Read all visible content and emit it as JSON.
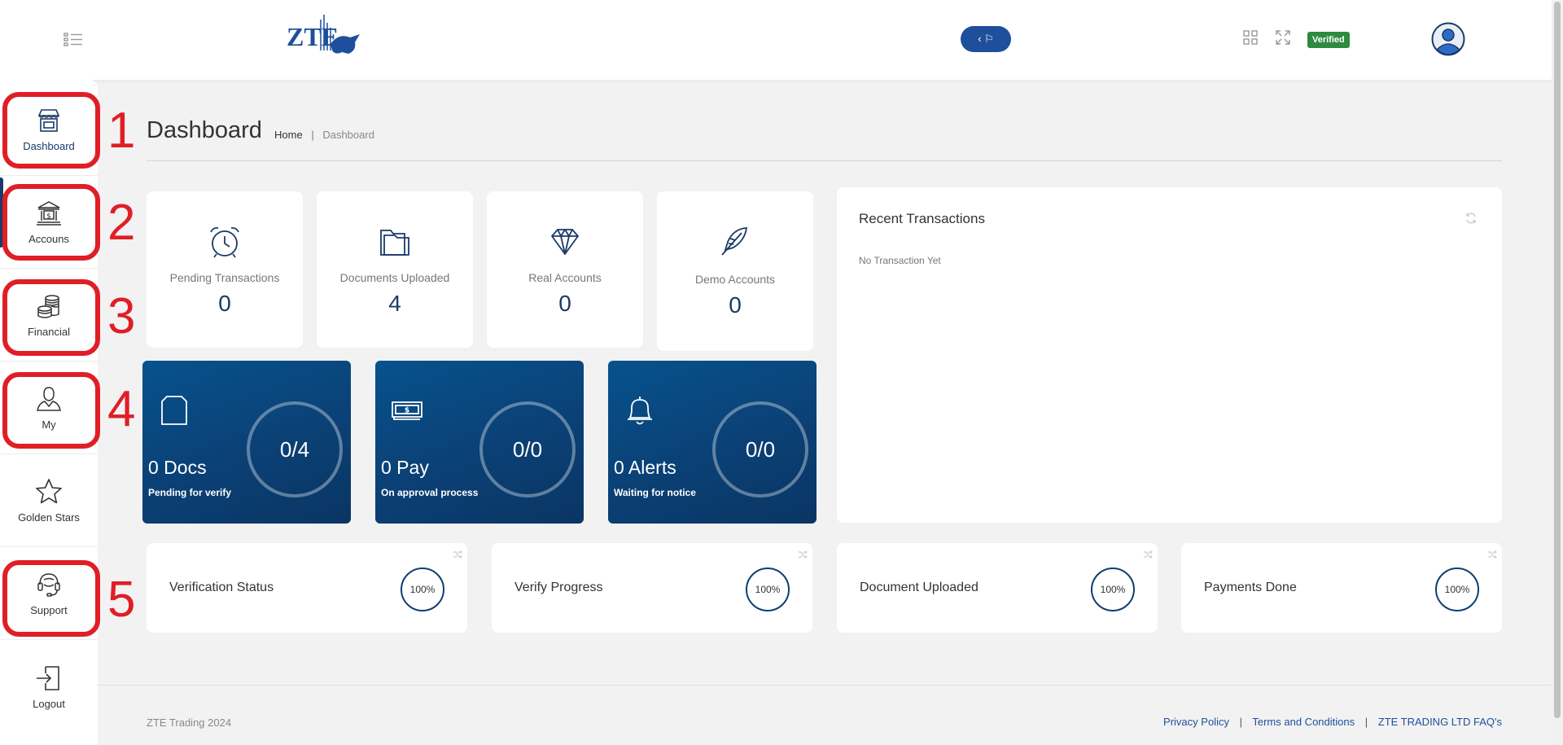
{
  "header": {
    "logo_text": "ZTE",
    "flag_button_label": "‹ ⚐",
    "verified_badge": "Verified"
  },
  "sidebar": {
    "items": [
      {
        "label": "Dashboard",
        "icon": "shop-icon"
      },
      {
        "label": "Accouns",
        "icon": "bank-icon"
      },
      {
        "label": "Financial",
        "icon": "coins-icon"
      },
      {
        "label": "My",
        "icon": "user-icon"
      },
      {
        "label": "Golden Stars",
        "icon": "star-icon"
      },
      {
        "label": "Support",
        "icon": "headset-icon"
      },
      {
        "label": "Logout",
        "icon": "logout-icon"
      }
    ]
  },
  "annotations": [
    "1",
    "2",
    "3",
    "4",
    "5"
  ],
  "page": {
    "title": "Dashboard",
    "breadcrumb": {
      "home": "Home",
      "separator": "|",
      "current": "Dashboard"
    }
  },
  "stats": [
    {
      "label": "Pending Transactions",
      "value": "0",
      "icon": "alarm-clock-icon"
    },
    {
      "label": "Documents Uploaded",
      "value": "4",
      "icon": "folder-icon"
    },
    {
      "label": "Real Accounts",
      "value": "0",
      "icon": "diamond-icon"
    },
    {
      "label": "Demo Accounts",
      "value": "0",
      "icon": "feather-icon"
    }
  ],
  "status_cards": [
    {
      "title": "0 Docs",
      "subtitle": "Pending for verify",
      "ratio": "0/4",
      "icon": "document-icon"
    },
    {
      "title": "0 Pay",
      "subtitle": "On approval process",
      "ratio": "0/0",
      "icon": "cash-icon"
    },
    {
      "title": "0 Alerts",
      "subtitle": "Waiting for notice",
      "ratio": "0/0",
      "icon": "bell-icon"
    }
  ],
  "recent_transactions": {
    "title": "Recent Transactions",
    "empty_text": "No Transaction Yet"
  },
  "progress_cards": [
    {
      "label": "Verification Status",
      "percent": "100%"
    },
    {
      "label": "Verify Progress",
      "percent": "100%"
    },
    {
      "label": "Document Uploaded",
      "percent": "100%"
    },
    {
      "label": "Payments Done",
      "percent": "100%"
    }
  ],
  "footer": {
    "copyright": "ZTE Trading 2024",
    "links": [
      "Privacy Policy",
      "Terms and Conditions",
      "ZTE TRADING LTD FAQ's"
    ],
    "separator": "|"
  },
  "colors": {
    "brand_navy": "#1b3a68",
    "card_blue": "#0b3f73",
    "annotation_red": "#e01e26",
    "verified_green": "#2e8a3f"
  }
}
